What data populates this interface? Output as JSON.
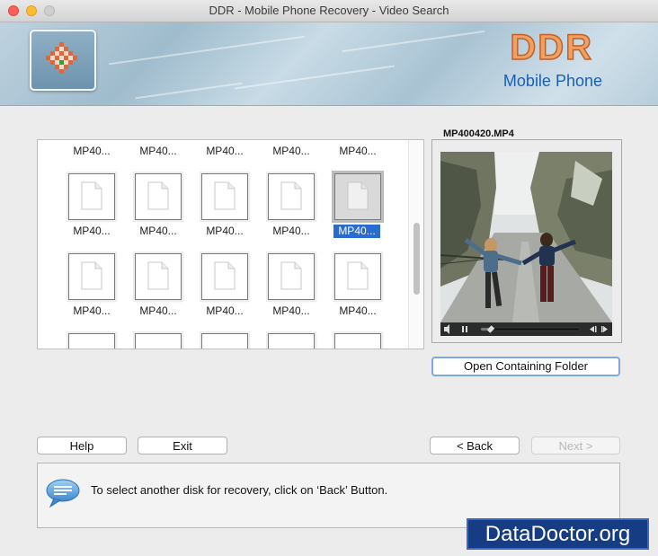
{
  "window": {
    "title": "DDR - Mobile Phone Recovery - Video Search"
  },
  "banner": {
    "brand": "DDR",
    "product": "Mobile Phone"
  },
  "grid": {
    "row0_labels": [
      "MP40...",
      "MP40...",
      "MP40...",
      "MP40...",
      "MP40..."
    ],
    "row1_labels": [
      "MP40...",
      "MP40...",
      "MP40...",
      "MP40...",
      "MP40..."
    ],
    "row2_labels": [
      "MP40...",
      "MP40...",
      "MP40...",
      "MP40...",
      "MP40..."
    ],
    "selected_label": "MP40..."
  },
  "preview": {
    "filename": "MP400420.MP4",
    "progress": 0.1
  },
  "buttons": {
    "open_folder": "Open Containing Folder",
    "help": "Help",
    "exit": "Exit",
    "back": "< Back",
    "next": "Next >"
  },
  "status": {
    "message": "To select another disk for recovery, click on ‘Back’ Button."
  },
  "watermark": "DataDoctor.org",
  "colors": {
    "selection": "#2a6bd0",
    "brand_orange": "#f0a060",
    "brand_blue": "#1b5fb0"
  }
}
